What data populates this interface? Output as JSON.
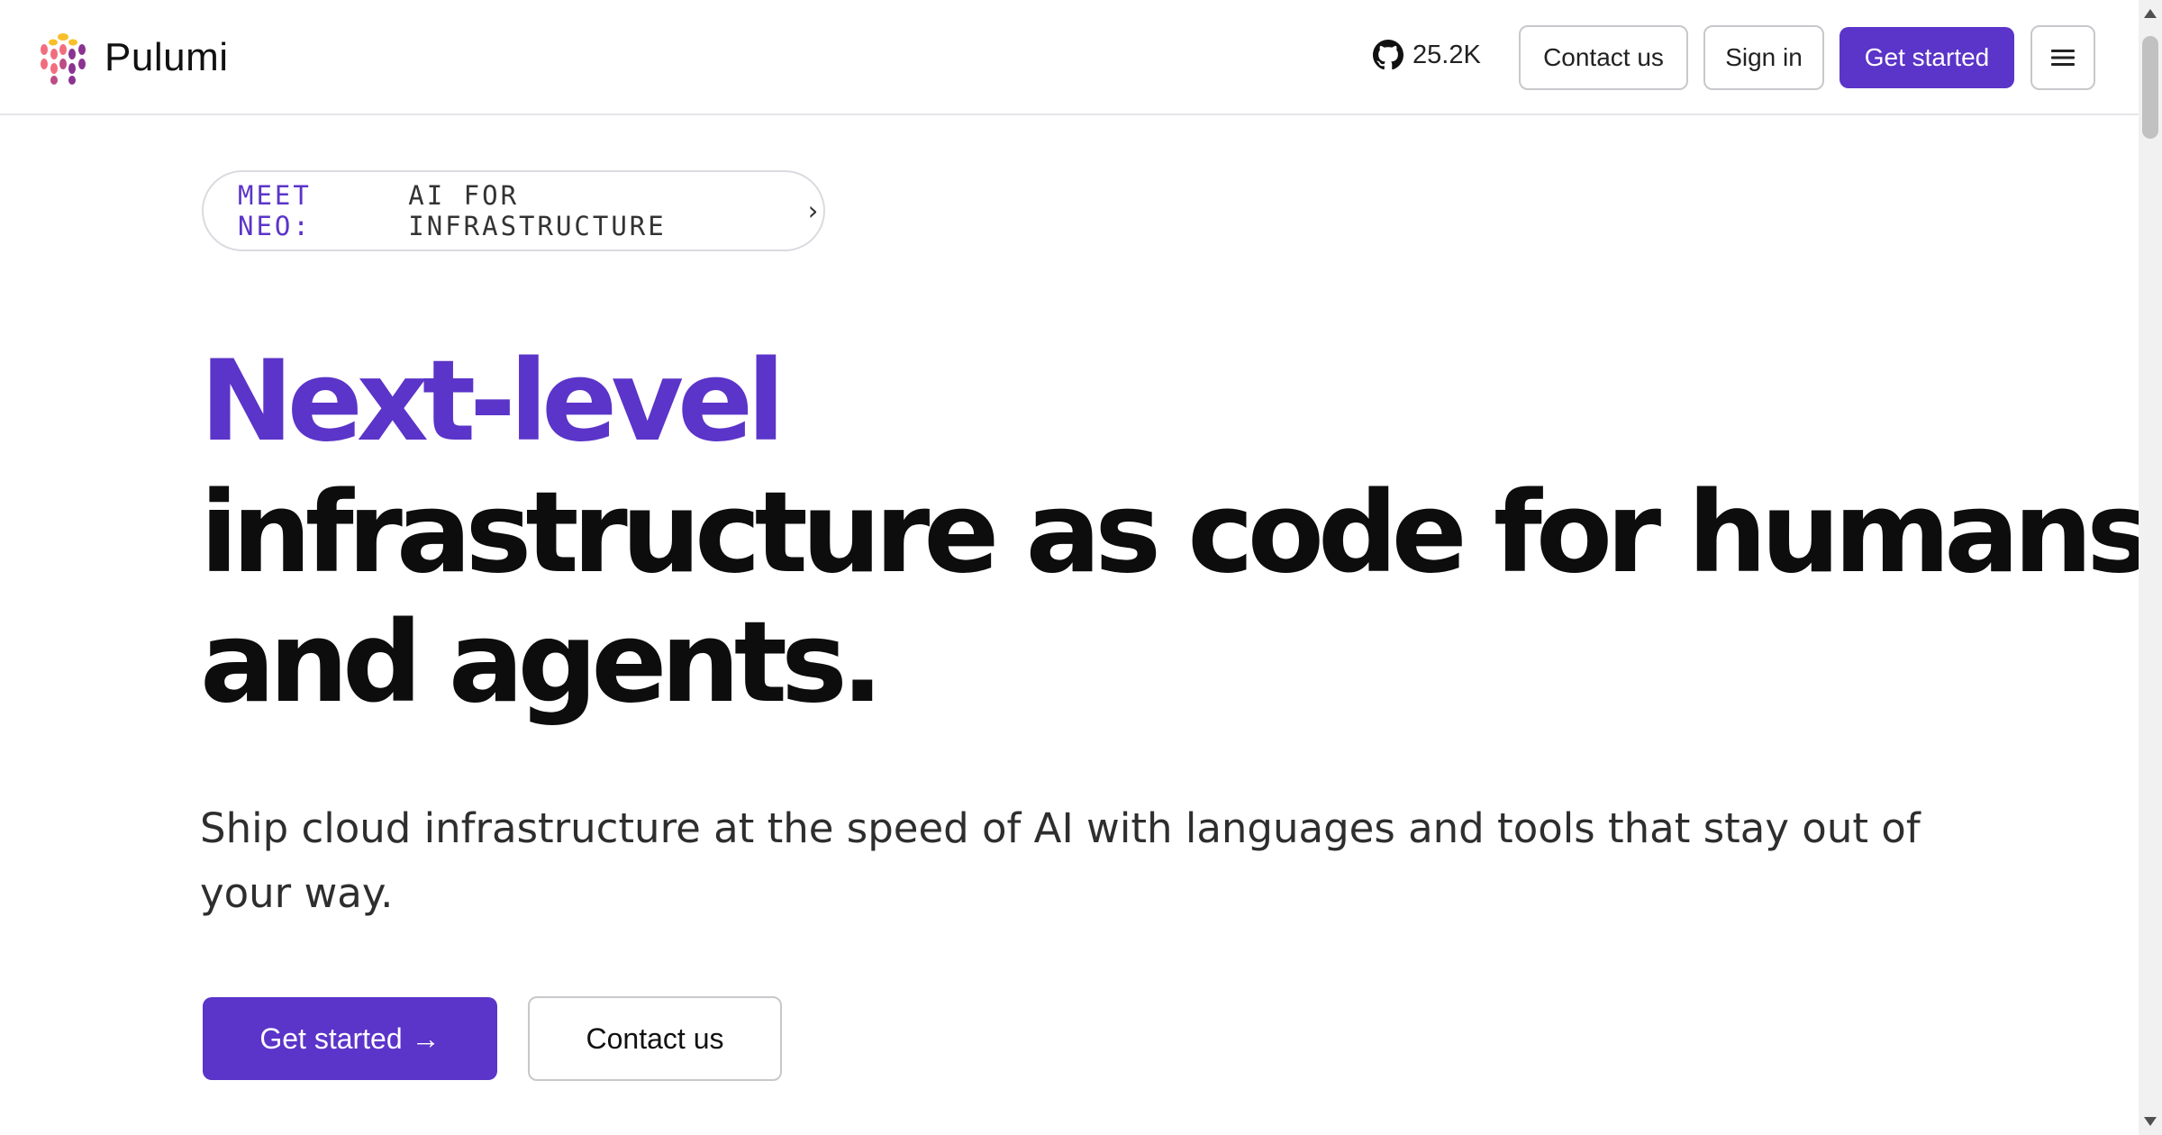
{
  "header": {
    "brand": "Pulumi",
    "github_stars": "25.2K",
    "contact_label": "Contact us",
    "signin_label": "Sign in",
    "get_started_label": "Get started"
  },
  "announcement": {
    "lead": "MEET NEO:",
    "text": "AI FOR INFRASTRUCTURE",
    "chevron": "›"
  },
  "hero": {
    "line1": "Next-level",
    "line2": "infrastructure as code for humans",
    "line3": "and agents."
  },
  "subtitle": "Ship cloud infrastructure at the speed of AI with languages and tools that stay out of your way.",
  "cta": {
    "primary_label": "Get started",
    "primary_arrow": "→",
    "secondary_label": "Contact us"
  },
  "colors": {
    "accent": "#5b34c9",
    "text": "#0d0d0d",
    "border": "#c8c8cc"
  },
  "icons": {
    "brand": "pulumi-logo-icon",
    "github": "github-icon",
    "menu": "hamburger-menu-icon"
  }
}
